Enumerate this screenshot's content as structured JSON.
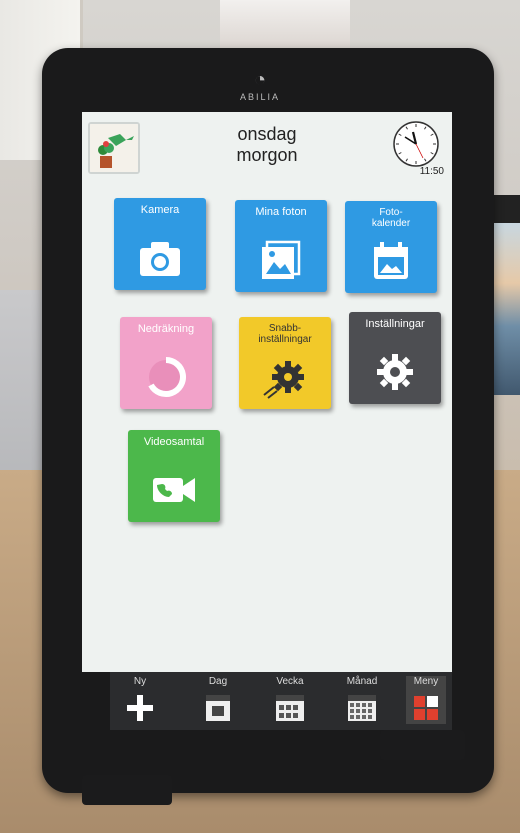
{
  "device": {
    "brand": "ABILIA"
  },
  "header": {
    "day": "onsdag",
    "day_part": "morgon",
    "time": "11:50"
  },
  "tiles": [
    {
      "label": "Kamera",
      "icon": "camera-icon"
    },
    {
      "label": "Mina foton",
      "icon": "photos-icon"
    },
    {
      "label": "Foto-\nkalender",
      "icon": "photo-calendar-icon"
    },
    {
      "label": "Nedräkning",
      "icon": "countdown-icon"
    },
    {
      "label": "Snabb-\ninställningar",
      "icon": "quick-settings-icon"
    },
    {
      "label": "Inställningar",
      "icon": "gear-icon"
    },
    {
      "label": "Videosamtal",
      "icon": "video-call-icon"
    }
  ],
  "bottom_nav": [
    {
      "label": "Ny",
      "icon": "plus-icon"
    },
    {
      "label": "Dag",
      "icon": "day-calendar-icon"
    },
    {
      "label": "Vecka",
      "icon": "week-calendar-icon"
    },
    {
      "label": "Månad",
      "icon": "month-calendar-icon"
    },
    {
      "label": "Meny",
      "icon": "menu-grid-icon"
    }
  ],
  "colors": {
    "tile_blue": "#2f9ae3",
    "tile_pink": "#f2a2c9",
    "tile_yellow": "#f2c929",
    "tile_dark": "#4d4e52",
    "tile_green": "#4cb84b",
    "screen_bg": "#eef2f0"
  }
}
